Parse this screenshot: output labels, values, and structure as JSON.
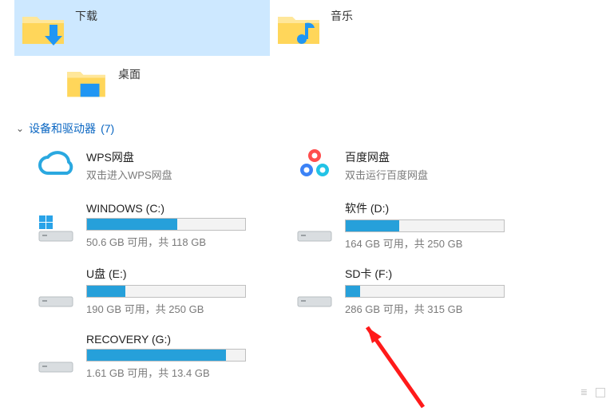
{
  "folders": {
    "downloads": {
      "label": "下载"
    },
    "music": {
      "label": "音乐"
    },
    "desktop": {
      "label": "桌面"
    }
  },
  "section": {
    "title": "设备和驱动器",
    "count": "(7)"
  },
  "cloud": {
    "wps": {
      "title": "WPS网盘",
      "sub": "双击进入WPS网盘"
    },
    "baidu": {
      "title": "百度网盘",
      "sub": "双击运行百度网盘"
    }
  },
  "drives": {
    "c": {
      "title": "WINDOWS (C:)",
      "sub": "50.6 GB 可用，共 118 GB",
      "fill_pct": 57
    },
    "d": {
      "title": "软件 (D:)",
      "sub": "164 GB 可用，共 250 GB",
      "fill_pct": 34
    },
    "e": {
      "title": "U盘 (E:)",
      "sub": "190 GB 可用，共 250 GB",
      "fill_pct": 24
    },
    "f": {
      "title": "SD卡 (F:)",
      "sub": "286 GB 可用，共 315 GB",
      "fill_pct": 9
    },
    "g": {
      "title": "RECOVERY (G:)",
      "sub": "1.61 GB 可用，共 13.4 GB",
      "fill_pct": 88
    }
  }
}
